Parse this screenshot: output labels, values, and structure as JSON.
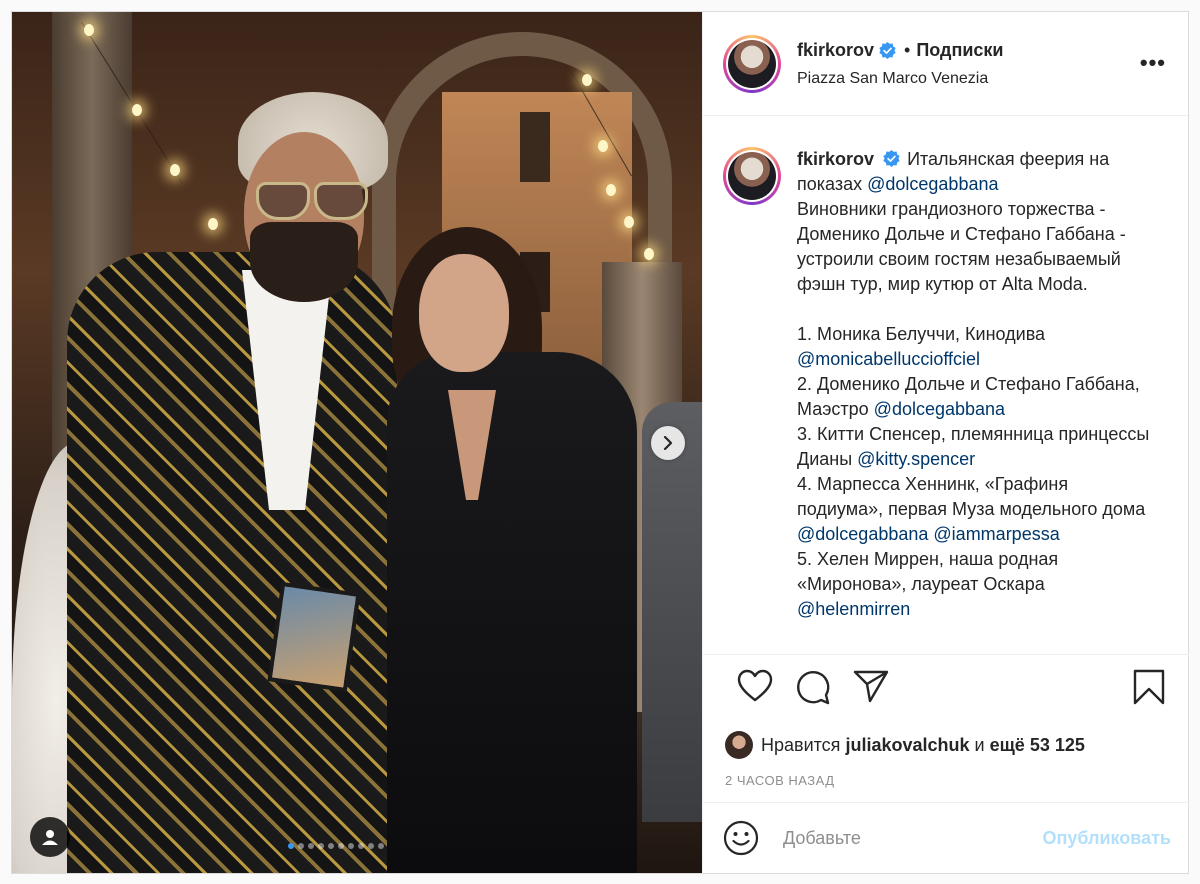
{
  "header": {
    "username": "fkirkorov",
    "follow_label": "Подписки",
    "bullet": "•",
    "location": "Piazza San Marco Venezia",
    "more": "•••"
  },
  "caption": {
    "username": "fkirkorov",
    "intro": "Итальянская феерия на показах ",
    "intro_mention": "@dolcegabbana",
    "p1": "Виновники грандиозного торжества - Доменико Дольче и Стефано Габбана - устроили своим гостям незабываемый фэшн тур, мир кутюр от Alta Moda.",
    "item1_text": "1. Моника Белуччи, Кинодива ",
    "item1_mention": "@monicabelluccioffciel",
    "item2_text": "2. Доменико Дольче и Стефано Габбана, Маэстро ",
    "item2_mention": "@dolcegabbana",
    "item3_text": "3. Китти Спенсер, племянница принцессы Дианы ",
    "item3_mention": "@kitty.spencer",
    "item4_text": "4. Марпесса Хеннинк, «Графиня подиума», первая Муза модельного дома ",
    "item4_mention1": "@dolcegabbana",
    "item4_mention2": "@iammarpessa",
    "item5_text": "5. Хелен Миррен, наша родная «Миронова», лауреат Оскара ",
    "item5_mention": "@helenmirren"
  },
  "likes": {
    "prefix": "Нравится",
    "user": "juliakovalchuk",
    "middle": "и",
    "count": "ещё 53 125"
  },
  "time": "2 ЧАСОВ НАЗАД",
  "comment": {
    "placeholder": "Добавьте",
    "publish": "Опубликовать"
  },
  "carousel": {
    "total": 10,
    "active": 0
  },
  "colors": {
    "link": "#00376b",
    "verified": "#3897f0",
    "publish_disabled": "#b2dffc"
  }
}
